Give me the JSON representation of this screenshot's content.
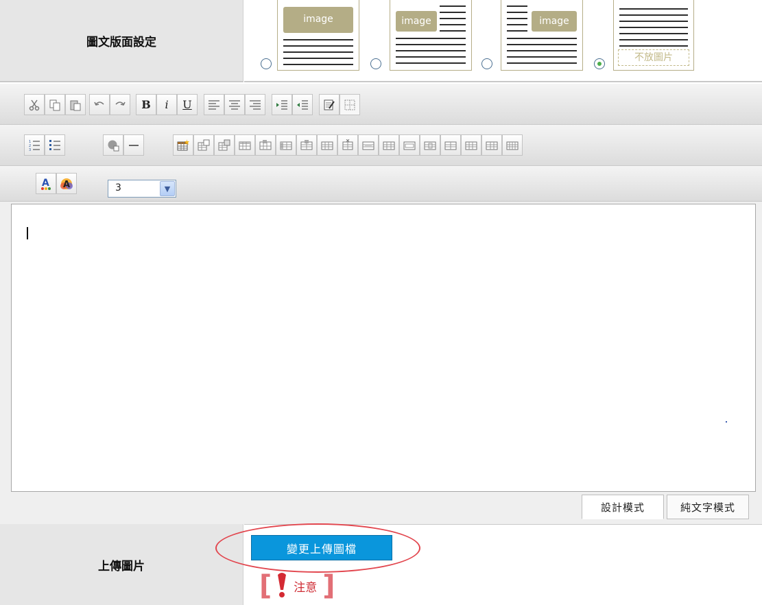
{
  "layout_row": {
    "label": "圖文版面設定",
    "options": [
      {
        "name": "image-top",
        "image_label": "image",
        "checked": false
      },
      {
        "name": "image-left",
        "image_label": "image",
        "checked": false
      },
      {
        "name": "image-right",
        "image_label": "image",
        "checked": false
      },
      {
        "name": "no-image",
        "no_image_label": "不放圖片",
        "checked": true
      }
    ]
  },
  "editor": {
    "font_size_select": {
      "value": "3"
    },
    "mode_tabs": [
      {
        "label": "設計模式",
        "active": true
      },
      {
        "label": "純文字模式",
        "active": false
      }
    ],
    "toolbar_icons_row1": [
      "cut-icon",
      "copy-icon",
      "paste-icon",
      "undo-icon",
      "redo-icon",
      "bold-icon",
      "italic-icon",
      "underline-icon",
      "align-left-icon",
      "align-center-icon",
      "align-right-icon",
      "indent-icon",
      "outdent-icon",
      "edit-source-icon",
      "table-borders-icon"
    ],
    "toolbar_icons_row2": [
      "ordered-list-icon",
      "unordered-list-icon",
      "insert-link-icon",
      "horizontal-rule-icon",
      "insert-table-icon",
      "table-props-icon",
      "cell-props-icon",
      "insert-row-above-icon",
      "insert-row-below-icon",
      "insert-col-left-icon",
      "insert-col-right-icon",
      "delete-row-icon",
      "delete-col-icon",
      "merge-cells-icon",
      "split-cell-icon"
    ],
    "toolbar_icons_row3": [
      "font-color-icon",
      "highlight-color-icon"
    ],
    "colors": {
      "toolbar_top": "#f4f4f4",
      "toolbar_bottom": "#dcdcdc",
      "accent_blue": "#0a96dc",
      "notice_red": "#cf2d35",
      "image_block": "#b4ad86"
    }
  },
  "upload_row": {
    "label": "上傳圖片",
    "button_label": "變更上傳圖檔",
    "notice_label": "注意"
  }
}
